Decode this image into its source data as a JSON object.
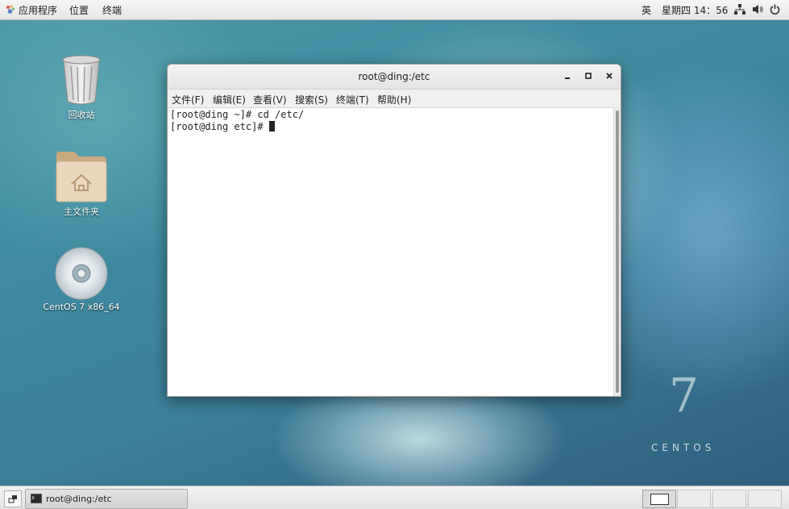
{
  "topbar": {
    "apps_label": "应用程序",
    "places_label": "位置",
    "terminal_label": "终端",
    "input_method": "英",
    "datetime": "星期四 14：56"
  },
  "desktop": {
    "icons": [
      {
        "label": "回收站"
      },
      {
        "label": "主文件夹"
      },
      {
        "label": "CentOS 7 x86_64"
      }
    ],
    "branding": {
      "number": "7",
      "word": "CENTOS"
    }
  },
  "terminal": {
    "title": "root@ding:/etc",
    "menu": [
      "文件(F)",
      "编辑(E)",
      "查看(V)",
      "搜索(S)",
      "终端(T)",
      "帮助(H)"
    ],
    "lines": [
      "[root@ding ~]# cd /etc/",
      "[root@ding etc]# "
    ]
  },
  "taskbar": {
    "task_label": "root@ding:/etc"
  }
}
